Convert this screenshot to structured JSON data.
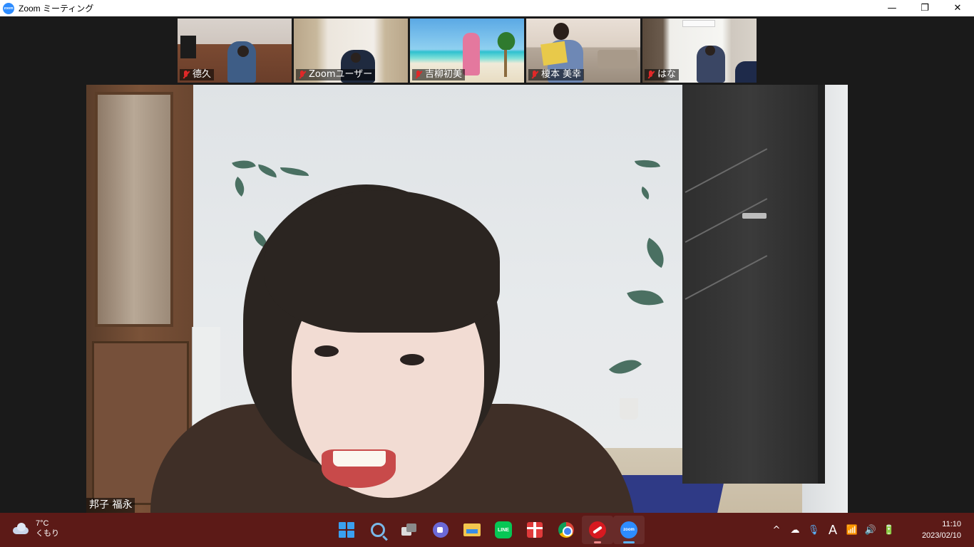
{
  "window": {
    "title": "Zoom ミーティング",
    "logo_text": "zoom",
    "minimize_label": "—",
    "maximize_label": "❐",
    "close_label": "✕"
  },
  "meeting": {
    "participants": [
      {
        "name": "德久",
        "muted": true
      },
      {
        "name": "Zoomユーザー",
        "muted": true
      },
      {
        "name": "吉柳初美",
        "muted": true
      },
      {
        "name": "榎本 美幸",
        "muted": true
      },
      {
        "name": "はな",
        "muted": true
      }
    ],
    "active_speaker": "邦子 福永"
  },
  "taskbar": {
    "weather": {
      "temp": "7°C",
      "condition": "くもり"
    },
    "apps": [
      {
        "name": "start"
      },
      {
        "name": "search"
      },
      {
        "name": "task-view"
      },
      {
        "name": "chat"
      },
      {
        "name": "file-explorer"
      },
      {
        "name": "line",
        "label": "LINE"
      },
      {
        "name": "gift"
      },
      {
        "name": "chrome"
      },
      {
        "name": "trend-micro"
      },
      {
        "name": "zoom",
        "label": "zoom"
      }
    ],
    "tray": {
      "chevron": "^",
      "ime": "A"
    },
    "clock": {
      "time": "11:10",
      "date": "2023/02/10"
    }
  },
  "colors": {
    "taskbar_bg": "#5c1a17",
    "zoom_blue": "#2d8cff",
    "mute_red": "#e02828"
  }
}
